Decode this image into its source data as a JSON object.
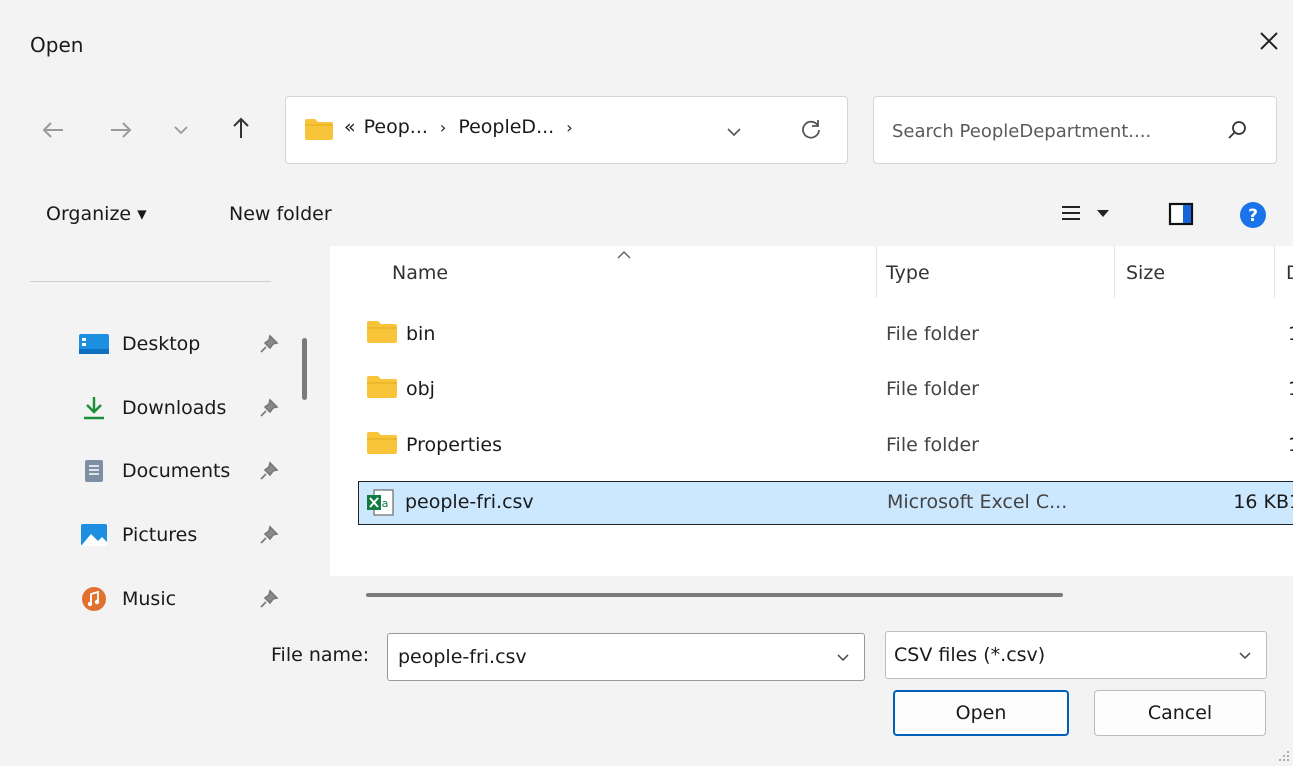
{
  "window": {
    "title": "Open"
  },
  "address": {
    "breadcrumb_prefix": "«",
    "crumbs": [
      "Peop...",
      "PeopleD..."
    ]
  },
  "search": {
    "placeholder": "Search PeopleDepartment...."
  },
  "toolbar": {
    "organize_label": "Organize ▾",
    "new_folder_label": "New folder"
  },
  "nav_pane": {
    "items": [
      {
        "label": "Desktop",
        "icon": "desktop-icon"
      },
      {
        "label": "Downloads",
        "icon": "download-arrow-icon"
      },
      {
        "label": "Documents",
        "icon": "documents-icon"
      },
      {
        "label": "Pictures",
        "icon": "pictures-icon"
      },
      {
        "label": "Music",
        "icon": "music-icon"
      }
    ]
  },
  "file_list": {
    "columns": {
      "name": "Name",
      "type": "Type",
      "size": "Size",
      "date_partial": "D"
    },
    "rows": [
      {
        "name": "bin",
        "type": "File folder",
        "size": "",
        "date_partial": "1",
        "icon": "folder-icon"
      },
      {
        "name": "obj",
        "type": "File folder",
        "size": "",
        "date_partial": "1",
        "icon": "folder-icon"
      },
      {
        "name": "Properties",
        "type": "File folder",
        "size": "",
        "date_partial": "1",
        "icon": "folder-icon"
      },
      {
        "name": "people-fri.csv",
        "type": "Microsoft Excel C...",
        "size": "16 KB",
        "date_partial": "1",
        "icon": "excel-csv-icon",
        "selected": true
      }
    ]
  },
  "bottom": {
    "filename_label": "File name:",
    "filename_value": "people-fri.csv",
    "filetype_value": "CSV files (*.csv)",
    "open_label": "Open",
    "cancel_label": "Cancel"
  },
  "colors": {
    "accent": "#005fb8",
    "selection": "#cce8ff",
    "folder": "#f8c43a",
    "help": "#1a73e8"
  }
}
